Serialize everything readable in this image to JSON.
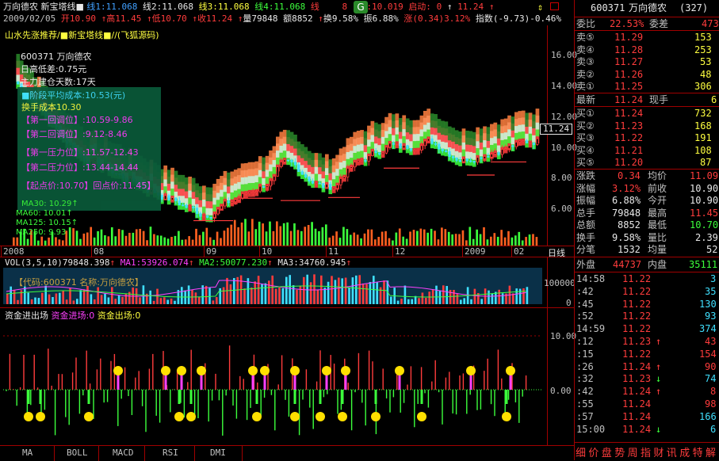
{
  "header": {
    "stock_name": "万向德农",
    "indicator": "新宝塔线",
    "lines": [
      {
        "label": "线1:11.068",
        "color": "#40a0ff"
      },
      {
        "label": "线2:11.068",
        "color": "#e8e8e8"
      },
      {
        "label": "线3:11.068",
        "color": "#ffff40"
      },
      {
        "label": "线4:11.068",
        "color": "#3cff3c"
      },
      {
        "label": "线",
        "color": "#ff3c3c"
      }
    ],
    "line1_tail": "8",
    "low_label": "低:10.019",
    "start_label": "启动:",
    "start_value": "0",
    "price_tail": "11.24",
    "date_line": [
      {
        "t": "2009/02/05",
        "c": "#c0c0c0"
      },
      {
        "t": "开10.90",
        "c": "#ff3c3c"
      },
      {
        "t": "↑",
        "c": "#ff3c3c"
      },
      {
        "t": "高11.45",
        "c": "#ff3c3c"
      },
      {
        "t": "↑",
        "c": "#ff3c3c"
      },
      {
        "t": "低10.70",
        "c": "#ff3c3c"
      },
      {
        "t": "↑",
        "c": "#ff3c3c"
      },
      {
        "t": "收11.24",
        "c": "#ff3c3c"
      },
      {
        "t": "↑",
        "c": "#ff3c3c"
      },
      {
        "t": "量79848",
        "c": "#e8e8e8"
      },
      {
        "t": "额8852",
        "c": "#e8e8e8"
      },
      {
        "t": "↑",
        "c": "#ff3c3c"
      },
      {
        "t": "换9.58%",
        "c": "#e8e8e8"
      },
      {
        "t": "振6.88%",
        "c": "#e8e8e8"
      },
      {
        "t": "涨(0.34)3.12%",
        "c": "#ff3c3c"
      },
      {
        "t": "指数(-9.73)-0.46%",
        "c": "#e8e8e8"
      }
    ]
  },
  "main_chart": {
    "title_line": "山水先涨推荐/■新宝塔线■//(飞狐源码)",
    "price_axis": [
      "16.00",
      "14.00",
      "12.00",
      "10.00",
      "8.00",
      "6.00"
    ],
    "current_price_tag": "11.24",
    "date_axis": [
      "2008",
      "08",
      "09",
      "10",
      "11",
      "12",
      "2009",
      "02"
    ],
    "period_label": "日线"
  },
  "popup": {
    "code_line": "600371 万向德农",
    "daily_diff": "日高低差:0.75元",
    "days": "主力建仓天数:17天",
    "avg_cost": "■阶段平均成本:10.53(元)",
    "hand_cost": "换手成本10.30",
    "r1": "【第一回调位】:10.59-9.86",
    "r2": "【第二回调位】:9.12-8.46",
    "p1": "【第一压力位】:11.57-12.43",
    "p2": "【第二压力位】:13.44-14.44",
    "start": "【起点价:10.70】回点价:11.45】",
    "ma30": "MA30: 10.29",
    "ma60": "MA60: 10.01",
    "ma125": "MA125: 10.15",
    "ma250": "MA250: 9.93"
  },
  "vol_pane": {
    "header": [
      {
        "t": "VOL(3,5,10)",
        "c": "#e8e8e8"
      },
      {
        "t": "79848.398",
        "c": "#e8e8e8"
      },
      {
        "t": "↑",
        "c": "#ff3c3c"
      },
      {
        "t": "MA1:53926.074",
        "c": "#ff40ff"
      },
      {
        "t": "↑",
        "c": "#ff3c3c"
      },
      {
        "t": "MA2:50077.230",
        "c": "#3cff3c"
      },
      {
        "t": "↑",
        "c": "#ff3c3c"
      },
      {
        "t": "MA3:34760.945",
        "c": "#e8e8e8"
      },
      {
        "t": "↑",
        "c": "#ff3c3c"
      }
    ],
    "banner": "【代码:600371 名称:万向德农】",
    "axis": [
      "100000",
      "0"
    ]
  },
  "money_pane": {
    "title": "资金进出场",
    "in_label": "资金进场:0",
    "out_label": "资金出场:0",
    "axis": [
      "10.00",
      "0.00"
    ]
  },
  "tabs": [
    "MA",
    "BOLL",
    "MACD",
    "RSI",
    "DMI"
  ],
  "quote": {
    "code": "600371",
    "name": "万向德农",
    "num": "(327)",
    "weibi_label": "委比",
    "weibi": "22.53%",
    "weicha_label": "委差",
    "weicha": "473",
    "sells": [
      {
        "label": "卖⑤",
        "price": "11.29",
        "vol": "153"
      },
      {
        "label": "卖④",
        "price": "11.28",
        "vol": "253"
      },
      {
        "label": "卖③",
        "price": "11.27",
        "vol": "53"
      },
      {
        "label": "卖②",
        "price": "11.26",
        "vol": "48"
      },
      {
        "label": "卖①",
        "price": "11.25",
        "vol": "306"
      }
    ],
    "latest_label": "最新",
    "latest": "11.24",
    "xianshou_label": "现手",
    "xianshou": "6",
    "buys": [
      {
        "label": "买①",
        "price": "11.24",
        "vol": "732"
      },
      {
        "label": "买②",
        "price": "11.23",
        "vol": "168"
      },
      {
        "label": "买③",
        "price": "11.22",
        "vol": "191"
      },
      {
        "label": "买④",
        "price": "11.21",
        "vol": "108"
      },
      {
        "label": "买⑤",
        "price": "11.20",
        "vol": "87"
      }
    ],
    "stats": [
      {
        "l1": "涨跌",
        "v1": "0.34",
        "c1": "#ff3c3c",
        "l2": "均价",
        "v2": "11.09",
        "c2": "#ff3c3c"
      },
      {
        "l1": "涨幅",
        "v1": "3.12%",
        "c1": "#ff3c3c",
        "l2": "前收",
        "v2": "10.90",
        "c2": "#e8e8e8"
      },
      {
        "l1": "振幅",
        "v1": "6.88%",
        "c1": "#e8e8e8",
        "l2": "今开",
        "v2": "10.90",
        "c2": "#e8e8e8"
      },
      {
        "l1": "总手",
        "v1": "79848",
        "c1": "#e8e8e8",
        "l2": "最高",
        "v2": "11.45",
        "c2": "#ff3c3c"
      },
      {
        "l1": "总额",
        "v1": "8852",
        "c1": "#e8e8e8",
        "l2": "最低",
        "v2": "10.70",
        "c2": "#3cff3c"
      },
      {
        "l1": "换手",
        "v1": "9.58%",
        "c1": "#e8e8e8",
        "l2": "量比",
        "v2": "2.39",
        "c2": "#e8e8e8"
      },
      {
        "l1": "分笔",
        "v1": "1532",
        "c1": "#e8e8e8",
        "l2": "均量",
        "v2": "52",
        "c2": "#e8e8e8"
      }
    ],
    "waipan_label": "外盘",
    "waipan": "44737",
    "neipan_label": "内盘",
    "neipan": "35111",
    "ticks": [
      {
        "t": "14:58",
        "p": "11.22",
        "a": "",
        "v": "3",
        "vc": "#40e0ff"
      },
      {
        "t": ":42",
        "p": "11.22",
        "a": "",
        "v": "35",
        "vc": "#40e0ff"
      },
      {
        "t": ":45",
        "p": "11.22",
        "a": "",
        "v": "130",
        "vc": "#40e0ff"
      },
      {
        "t": ":52",
        "p": "11.22",
        "a": "",
        "v": "93",
        "vc": "#40e0ff"
      },
      {
        "t": "14:59",
        "p": "11.22",
        "a": "",
        "v": "374",
        "vc": "#40e0ff"
      },
      {
        "t": ":12",
        "p": "11.23",
        "a": "↑",
        "v": "43",
        "vc": "#ff3c3c"
      },
      {
        "t": ":15",
        "p": "11.22",
        "a": "",
        "v": "154",
        "vc": "#ff3c3c"
      },
      {
        "t": ":26",
        "p": "11.24",
        "a": "↑",
        "v": "90",
        "vc": "#ff3c3c"
      },
      {
        "t": ":32",
        "p": "11.23",
        "a": "↓",
        "v": "74",
        "vc": "#40e0ff"
      },
      {
        "t": ":42",
        "p": "11.24",
        "a": "↑",
        "v": "8",
        "vc": "#ff3c3c"
      },
      {
        "t": ":55",
        "p": "11.24",
        "a": "",
        "v": "98",
        "vc": "#ff3c3c"
      },
      {
        "t": ":57",
        "p": "11.24",
        "a": "",
        "v": "166",
        "vc": "#40e0ff"
      },
      {
        "t": "15:00",
        "p": "11.24",
        "a": "↓",
        "v": "6",
        "vc": "#40e0ff"
      }
    ],
    "bottom_tabs": [
      "细",
      "价",
      "盘",
      "势",
      "周",
      "指",
      "财",
      "讯",
      "成",
      "特",
      "解"
    ]
  }
}
